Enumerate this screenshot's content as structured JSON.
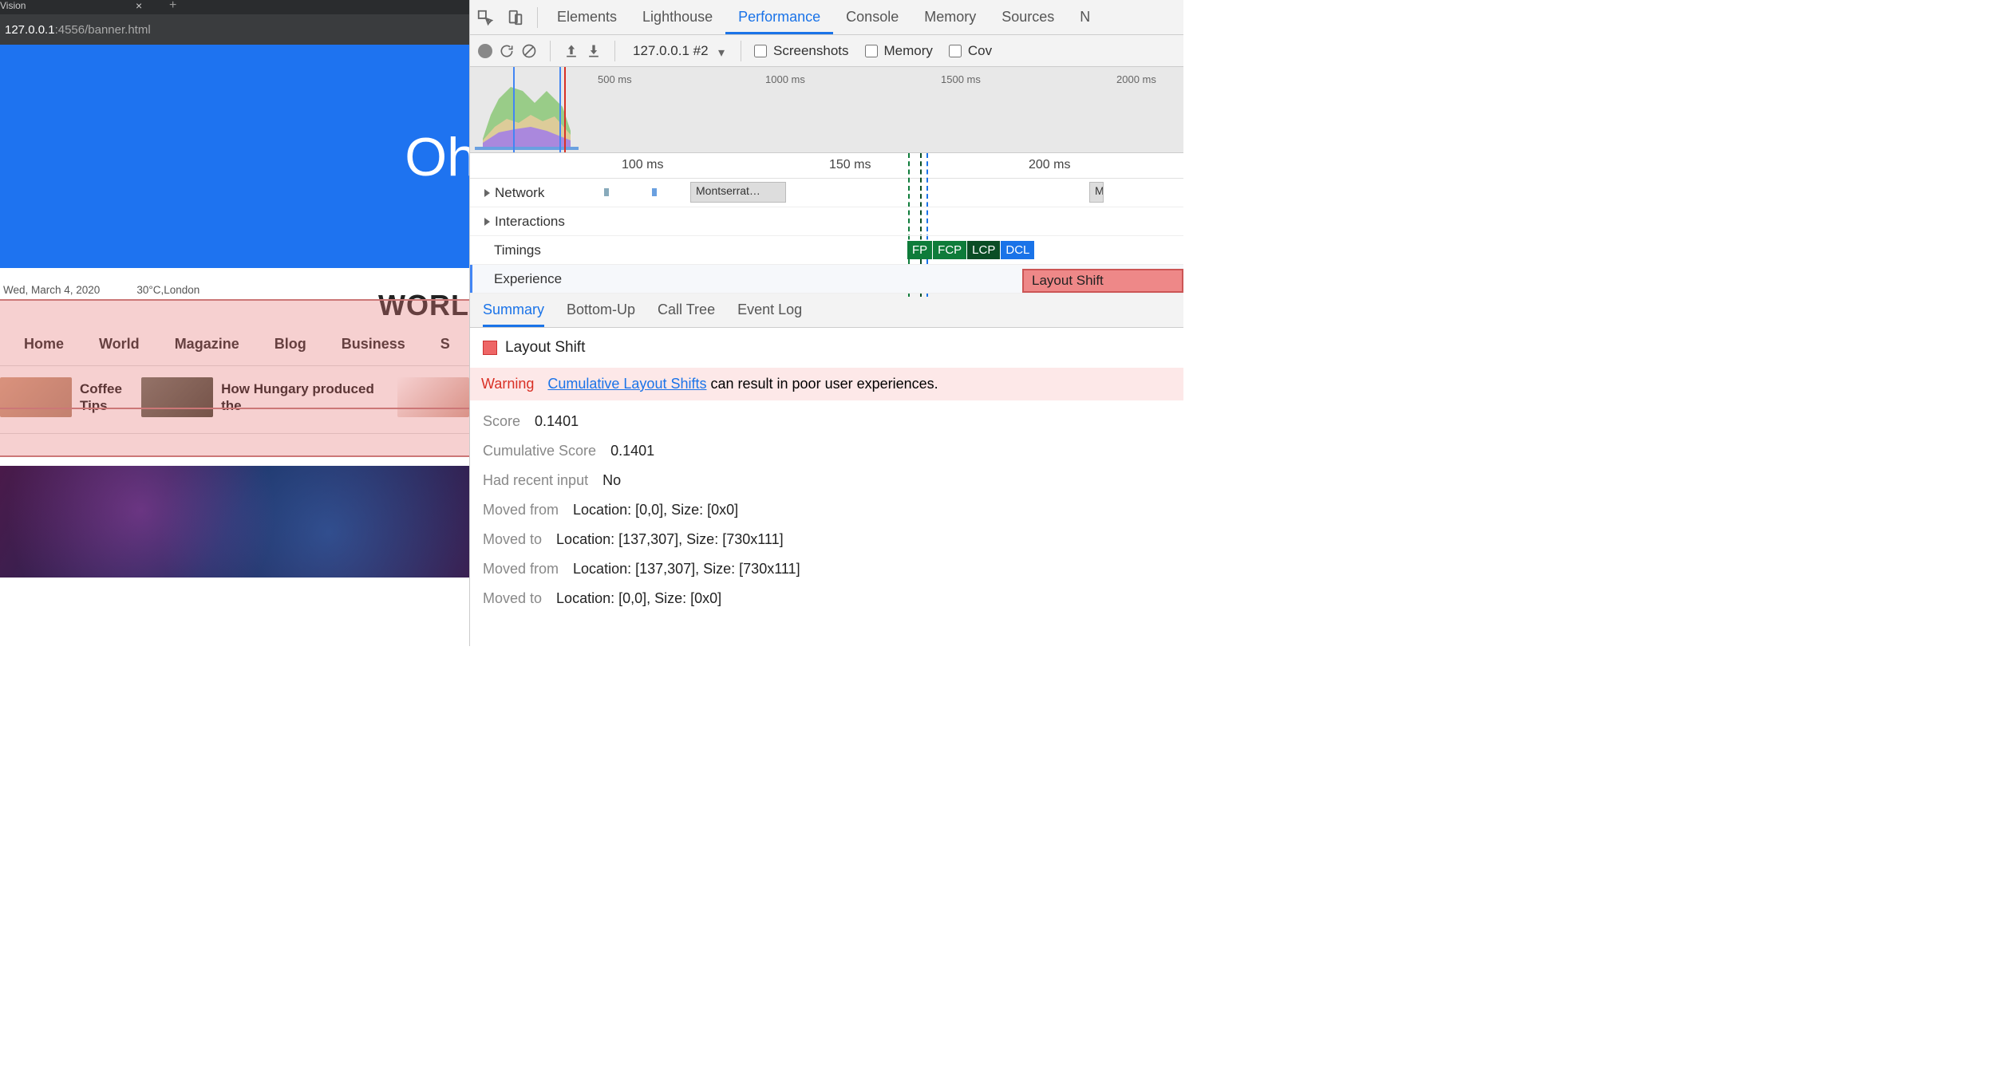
{
  "browser": {
    "tab_label": "Vision",
    "url_host": "127.0.0.1",
    "url_port": ":4556",
    "url_path": "/banner.html"
  },
  "page": {
    "banner_text": "Oh",
    "date": "Wed, March 4, 2020",
    "weather": "30°C,London",
    "site_title": "WORL",
    "nav": [
      "Home",
      "World",
      "Magazine",
      "Blog",
      "Business",
      "S"
    ],
    "tickers": [
      {
        "title": "Coffee Tips"
      },
      {
        "title": "How Hungary produced the"
      }
    ]
  },
  "devtools": {
    "panels": [
      "Elements",
      "Lighthouse",
      "Performance",
      "Console",
      "Memory",
      "Sources",
      "N"
    ],
    "active_panel": "Performance",
    "toolbar": {
      "profile_select": "127.0.0.1 #2",
      "chk_screenshots": "Screenshots",
      "chk_memory": "Memory",
      "chk_cov": "Cov"
    },
    "overview_ticks": [
      "500 ms",
      "1000 ms",
      "1500 ms",
      "2000 ms"
    ],
    "ruler_ticks": [
      "100 ms",
      "150 ms",
      "200 ms"
    ],
    "tracks": {
      "network": "Network",
      "network_item": "Montserrat…",
      "network_item2": "M",
      "interactions": "Interactions",
      "timings": "Timings",
      "experience": "Experience",
      "timing_badges": {
        "fp": "FP",
        "fcp": "FCP",
        "lcp": "LCP",
        "dcl": "DCL"
      },
      "experience_block": "Layout Shift"
    },
    "detail_tabs": [
      "Summary",
      "Bottom-Up",
      "Call Tree",
      "Event Log"
    ],
    "active_detail": "Summary",
    "summary": {
      "title": "Layout Shift",
      "warning_label": "Warning",
      "warning_link": "Cumulative Layout Shifts",
      "warning_tail": " can result in poor user experiences.",
      "score_k": "Score",
      "score_v": "0.1401",
      "cum_k": "Cumulative Score",
      "cum_v": "0.1401",
      "input_k": "Had recent input",
      "input_v": "No",
      "mf1_k": "Moved from",
      "mf1_v": "Location: [0,0], Size: [0x0]",
      "mt1_k": "Moved to",
      "mt1_v": "Location: [137,307], Size: [730x111]",
      "mf2_k": "Moved from",
      "mf2_v": "Location: [137,307], Size: [730x111]",
      "mt2_k": "Moved to",
      "mt2_v": "Location: [0,0], Size: [0x0]"
    }
  }
}
